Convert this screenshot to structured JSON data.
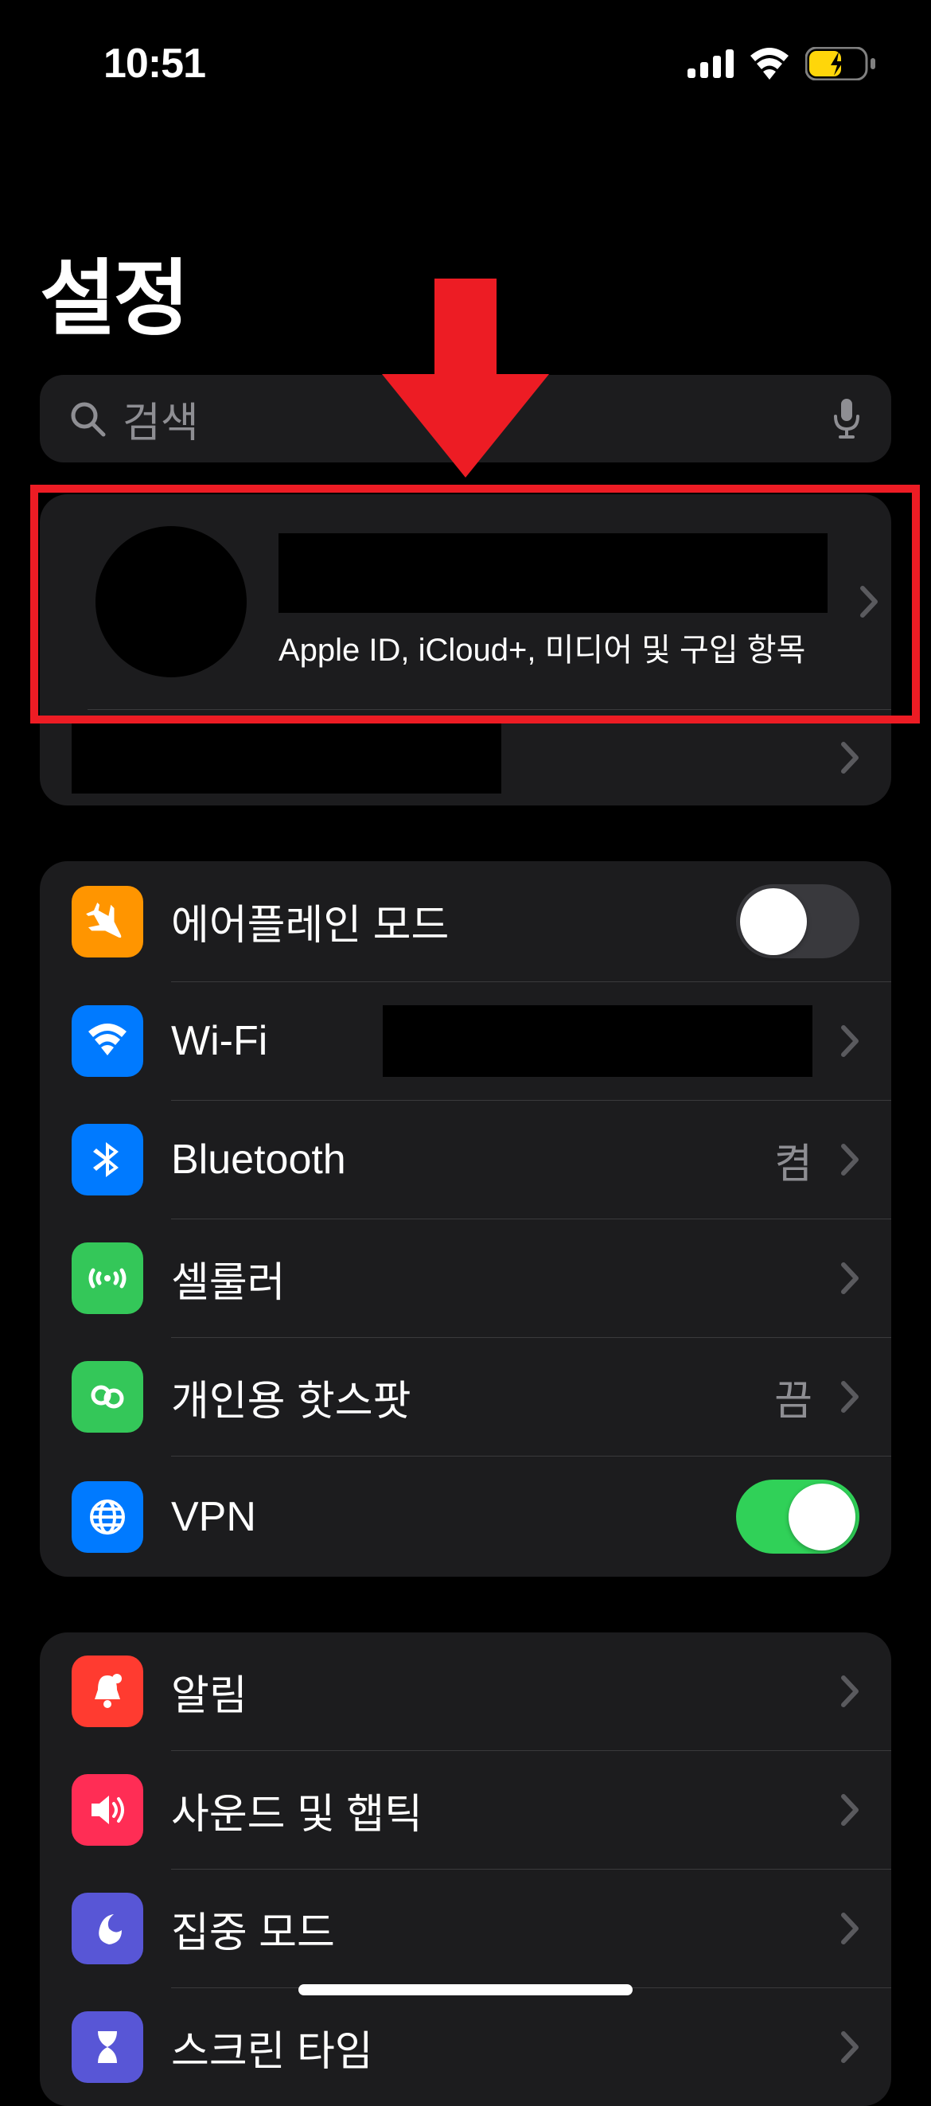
{
  "status": {
    "time": "10:51"
  },
  "page": {
    "title": "설정"
  },
  "search": {
    "placeholder": "검색"
  },
  "account": {
    "subtitle": "Apple ID, iCloud+, 미디어 및 구입 항목"
  },
  "group1": {
    "airplane": {
      "label": "에어플레인 모드",
      "toggle": false
    },
    "wifi": {
      "label": "Wi-Fi"
    },
    "bluetooth": {
      "label": "Bluetooth",
      "value": "켬"
    },
    "cellular": {
      "label": "셀룰러"
    },
    "hotspot": {
      "label": "개인용 핫스팟",
      "value": "끔"
    },
    "vpn": {
      "label": "VPN",
      "toggle": true
    }
  },
  "group2": {
    "notifications": {
      "label": "알림"
    },
    "sound": {
      "label": "사운드 및 햅틱"
    },
    "focus": {
      "label": "집중 모드"
    },
    "screentime": {
      "label": "스크린 타임"
    }
  }
}
